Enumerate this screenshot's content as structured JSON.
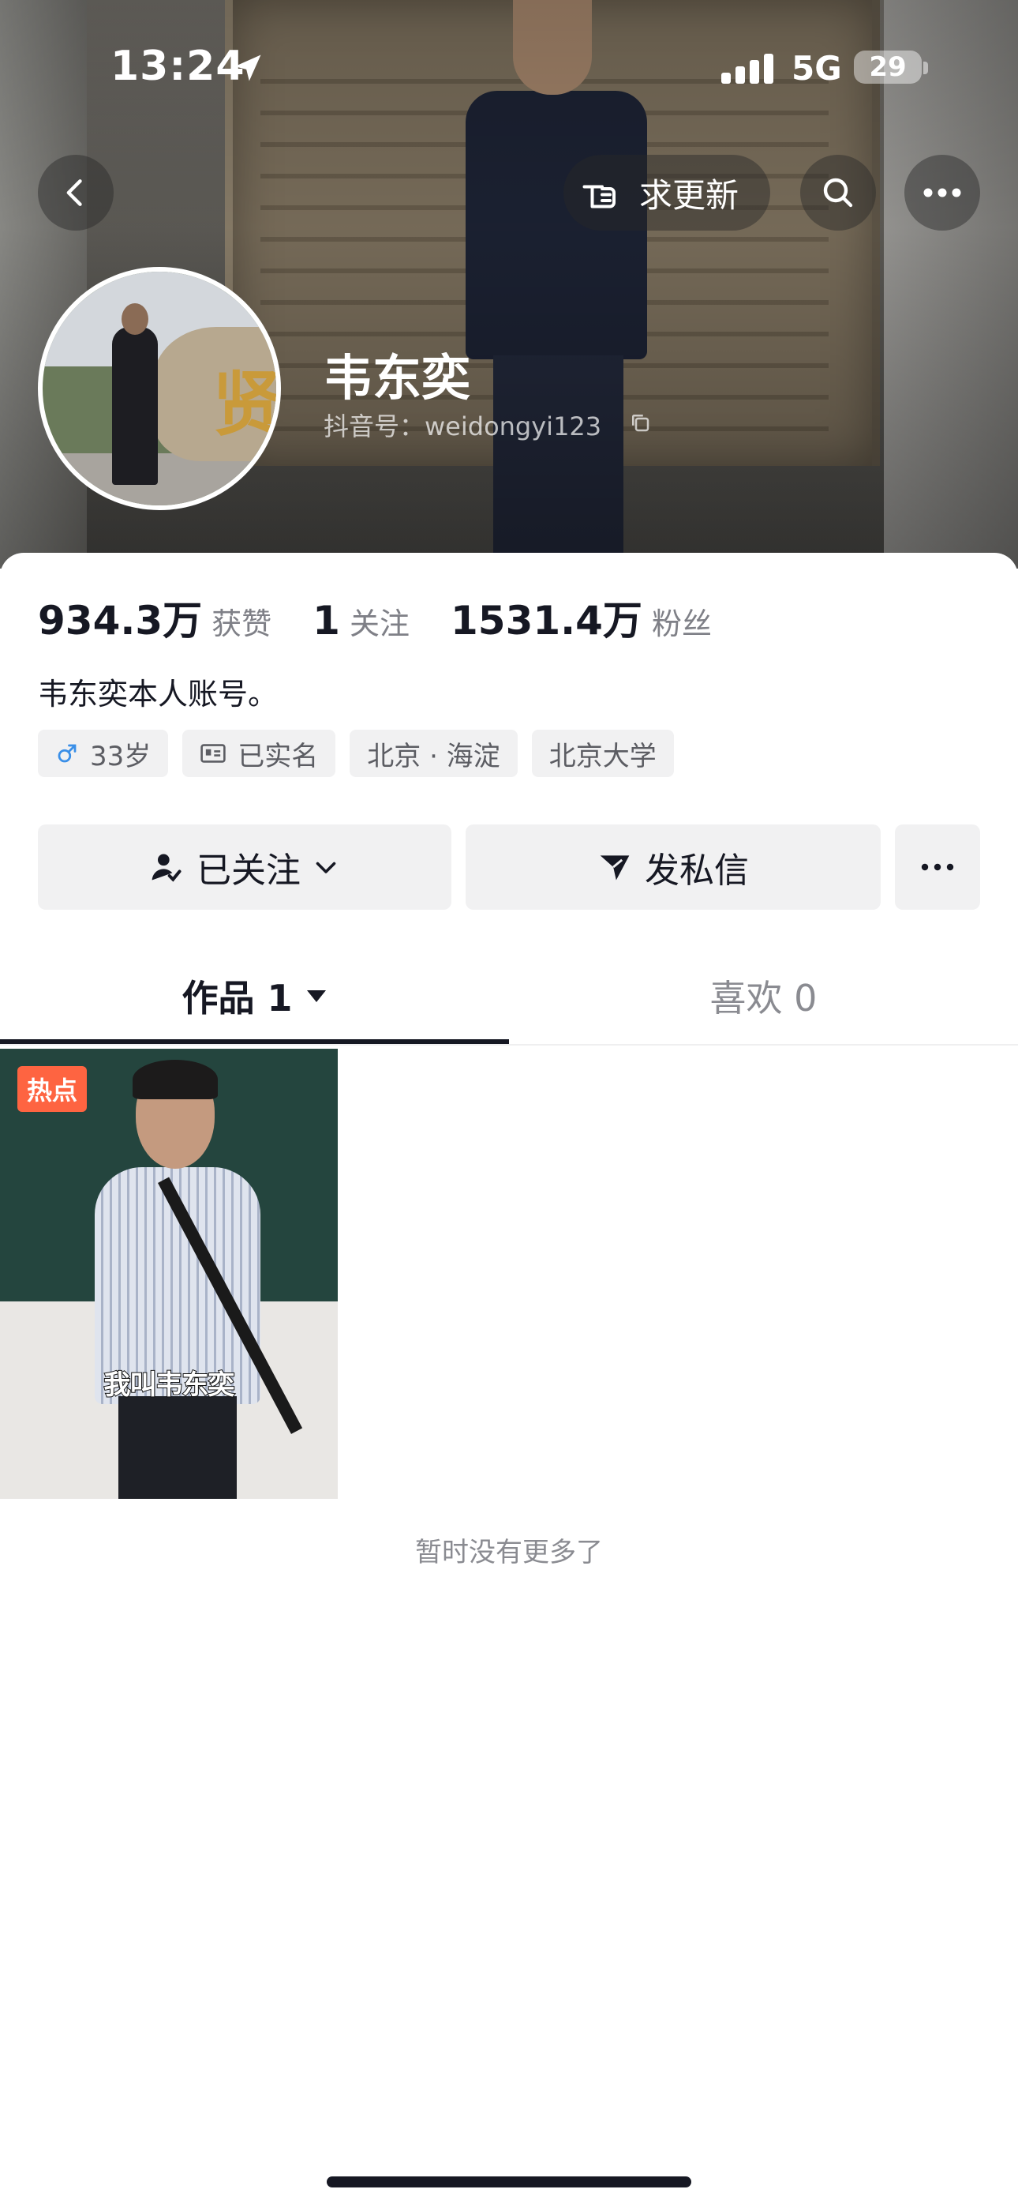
{
  "status_bar": {
    "time": "13:24",
    "network": "5G",
    "battery": "29"
  },
  "header": {
    "update_button_label": "求更新",
    "back_icon": "chevron-left-icon",
    "search_icon": "search-icon",
    "more_icon": "ellipsis-icon"
  },
  "profile": {
    "name": "韦东奕",
    "douyin_id": "抖音号：weidongyi123",
    "avatar_character": "贤",
    "stats": [
      {
        "value": "934.3万",
        "label": "获赞"
      },
      {
        "value": "1",
        "label": "关注"
      },
      {
        "value": "1531.4万",
        "label": "粉丝"
      }
    ],
    "bio": "韦东奕本人账号。",
    "tags": {
      "age": "33岁",
      "verified": "已实名",
      "location": "北京 · 海淀",
      "school": "北京大学"
    }
  },
  "actions": {
    "follow_label": "已关注",
    "message_label": "发私信"
  },
  "tabs": {
    "works": "作品 1",
    "likes": "喜欢 0"
  },
  "videos": [
    {
      "badge": "热点",
      "caption": "我叫韦东奕"
    }
  ],
  "footer_text": "暂时没有更多了",
  "colors": {
    "hot_badge": "#fe6441",
    "text_primary": "#161823",
    "text_secondary": "#8a8b91",
    "button_bg": "#f1f1f2",
    "male_icon": "#3a8fe8"
  }
}
